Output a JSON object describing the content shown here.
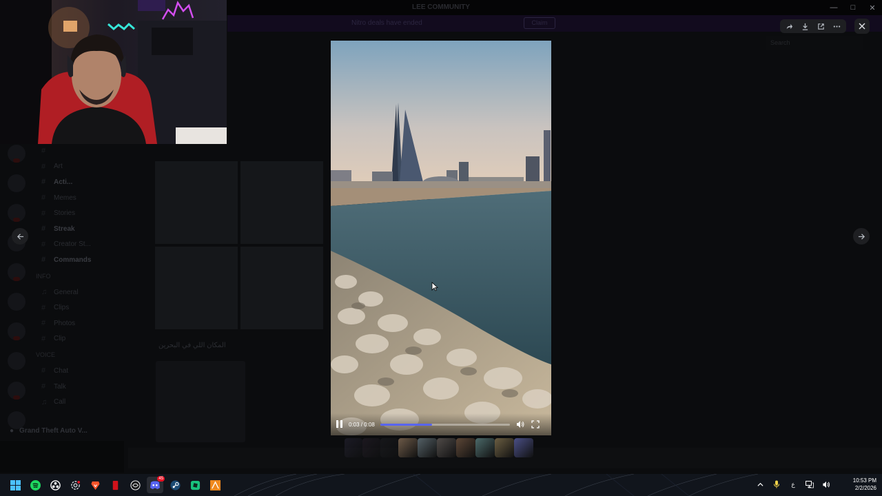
{
  "window": {
    "title": "LEE COMMUNITY"
  },
  "banner": {
    "text": "Nitro deals have ended",
    "button_label": "Claim"
  },
  "channels": [
    {
      "name": "cat",
      "label": "",
      "bold": false
    },
    {
      "name": "art",
      "label": "Art",
      "bold": false
    },
    {
      "name": "acts",
      "label": "Acti...",
      "bold": true
    },
    {
      "name": "memes",
      "label": "Memes",
      "bold": false
    },
    {
      "name": "stories",
      "label": "Stories",
      "bold": false
    },
    {
      "name": "streak",
      "label": "Streak",
      "bold": true
    },
    {
      "name": "creator",
      "label": "Creator St...",
      "bold": false
    },
    {
      "name": "commands",
      "label": "Commands",
      "bold": true
    }
  ],
  "channels_cat": "INFO",
  "channels2": [
    {
      "name": "general",
      "label": "General"
    },
    {
      "name": "clips",
      "label": "Clips"
    },
    {
      "name": "photos",
      "label": "Photos"
    },
    {
      "name": "clip",
      "label": "Clip"
    }
  ],
  "channels_cat2": "VOICE",
  "channels3": [
    {
      "name": "chat",
      "label": "Chat"
    },
    {
      "name": "talk",
      "label": "Talk"
    },
    {
      "name": "call",
      "label": "Call"
    }
  ],
  "status_activity": "Grand Theft Auto V...",
  "message_text": "المكان اللي في البحرين",
  "composer_placeholder": "",
  "search_placeholder": "Search",
  "viewer": {
    "tools": [
      "forward-icon",
      "download-icon",
      "open-external-icon",
      "more-icon"
    ],
    "close": "close-icon"
  },
  "video": {
    "current_time": "0:03",
    "duration": "0:08",
    "time_label": "0:03 / 0:08",
    "progress": 0.4
  },
  "thumbnails": [
    {
      "color": "#3a3650"
    },
    {
      "color": "#3b2f3f"
    },
    {
      "color": "#2d2d32"
    },
    {
      "color": "#6d5a48"
    },
    {
      "color": "#546066"
    },
    {
      "color": "#4f4a48"
    },
    {
      "color": "#5c4636"
    },
    {
      "color": "#4c6a6a"
    },
    {
      "color": "#6b5e42"
    },
    {
      "color": "#4a4f86"
    }
  ],
  "taskbar": {
    "apps": [
      "windows-start-icon",
      "spotify-icon",
      "obs-icon",
      "settings-icon",
      "brave-icon",
      "app-red-icon",
      "chatgpt-icon",
      "discord-icon",
      "steam-icon",
      "roblox-icon",
      "autodesk-icon"
    ],
    "discord_badge": "45",
    "language": "ع",
    "time": "10:53 PM",
    "date": "2/2/2026"
  },
  "colors": {
    "accent": "#5865f2",
    "viewer_button_bg": "#1e1f22"
  }
}
